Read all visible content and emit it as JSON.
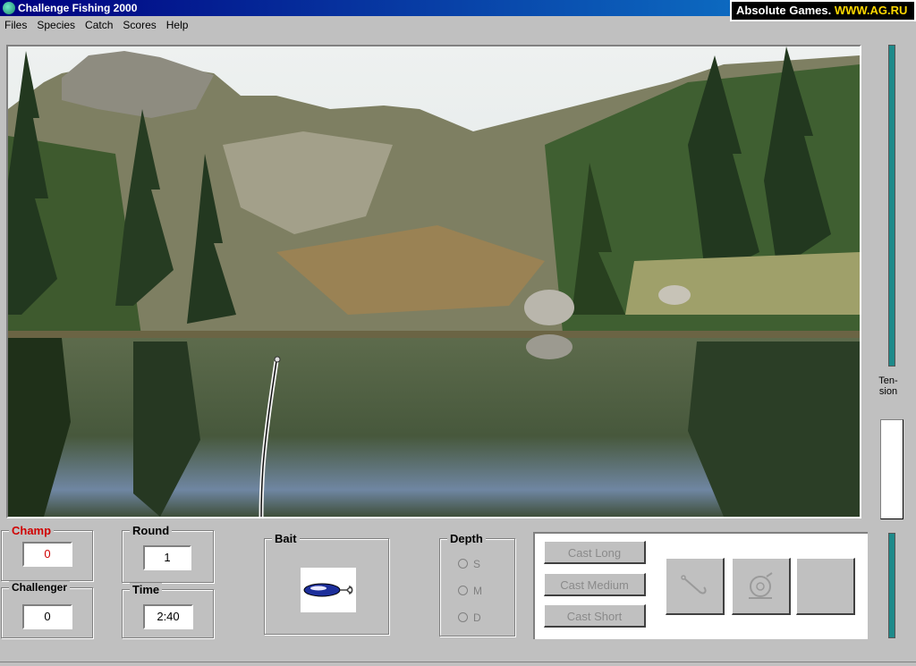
{
  "window": {
    "title": "Challenge Fishing 2000"
  },
  "brand": {
    "text": "Absolute Games. ",
    "url": "WWW.AG.RU"
  },
  "menu": [
    "Files",
    "Species",
    "Catch",
    "Scores",
    "Help"
  ],
  "scores": {
    "champ_label": "Champ",
    "champ_value": "0",
    "challenger_label": "Challenger",
    "challenger_value": "0"
  },
  "game": {
    "round_label": "Round",
    "round_value": "1",
    "time_label": "Time",
    "time_value": "2:40"
  },
  "bait": {
    "label": "Bait"
  },
  "depth": {
    "label": "Depth",
    "options": [
      "S",
      "M",
      "D"
    ]
  },
  "cast": {
    "long": "Cast Long",
    "medium": "Cast Medium",
    "short": "Cast Short"
  },
  "tension": {
    "label_1": "Ten-",
    "label_2": "sion"
  },
  "colors": {
    "tension": "#1e8a8a",
    "champ": "#d00000",
    "title_bar": "#000080"
  }
}
